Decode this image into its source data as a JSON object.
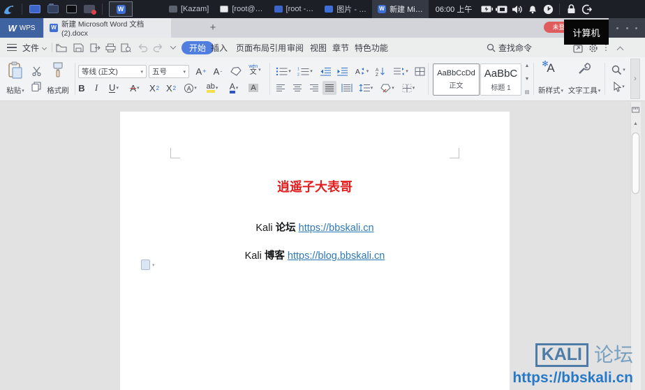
{
  "taskbar": {
    "windows": [
      {
        "label": "[Kazam]"
      },
      {
        "label": "[root@…"
      },
      {
        "label": "[root -…"
      },
      {
        "label": "图片 - …"
      },
      {
        "label": "新建 Mi…"
      }
    ],
    "clock": "06:00 上午"
  },
  "titlebar": {
    "brand_w": "W",
    "brand": "WPS",
    "tab_title": "新建 Microsoft Word 文档 (2).docx",
    "tab_icon": "W",
    "new_tab": "+",
    "login_badge": "未登录",
    "tooltip": "计算机"
  },
  "menubar": {
    "file_label": "文件",
    "tabs": [
      {
        "label": "开始"
      },
      {
        "label": "插入"
      },
      {
        "label": "页面布局"
      },
      {
        "label": "引用"
      },
      {
        "label": "审阅"
      },
      {
        "label": "视图"
      },
      {
        "label": "章节"
      },
      {
        "label": "特色功能"
      }
    ],
    "search_label": "查找命令"
  },
  "ribbon": {
    "paste_label": "粘贴",
    "format_painter_label": "格式刷",
    "font_name": "等线 (正文)",
    "font_size": "五号",
    "bold": "B",
    "italic": "I",
    "underline": "U",
    "strike": "A",
    "sup_base": "X",
    "sup": "2",
    "sub": "2",
    "effects": "A",
    "highlight": "ab",
    "fontcolor": "A",
    "shading": "A",
    "inc_font": "A",
    "inc_sign": "+",
    "dec_font": "A",
    "dec_sign": "-",
    "phonetic_top": "wén",
    "phonetic_char": "文",
    "styles": [
      {
        "sample": "AaBbCcDd",
        "label": "正文"
      },
      {
        "sample": "AaBbC",
        "label": "标题 1"
      }
    ],
    "new_style_label": "新样式",
    "text_tools_label": "文字工具",
    "expander": "›"
  },
  "document": {
    "title": "逍遥子大表哥",
    "lines": [
      {
        "plain": "Kali ",
        "bold": "论坛",
        "link": "https://bbskali.cn"
      },
      {
        "plain": "Kali ",
        "bold": "博客",
        "link": "https://blog.bbskali.cn"
      }
    ]
  },
  "watermark": {
    "badge": "KALI",
    "title": "论坛",
    "url": "https://bbskali.cn"
  },
  "colors": {
    "accent_blue": "#4f7ee0",
    "login_badge_red": "#e05c5c",
    "doc_title_red": "#e21d1d",
    "hyperlink": "#2e79b9",
    "watermark_blue": "#4e7ca6",
    "watermark_title_blue": "#7aa0bf",
    "watermark_url_blue": "#2878c8"
  }
}
